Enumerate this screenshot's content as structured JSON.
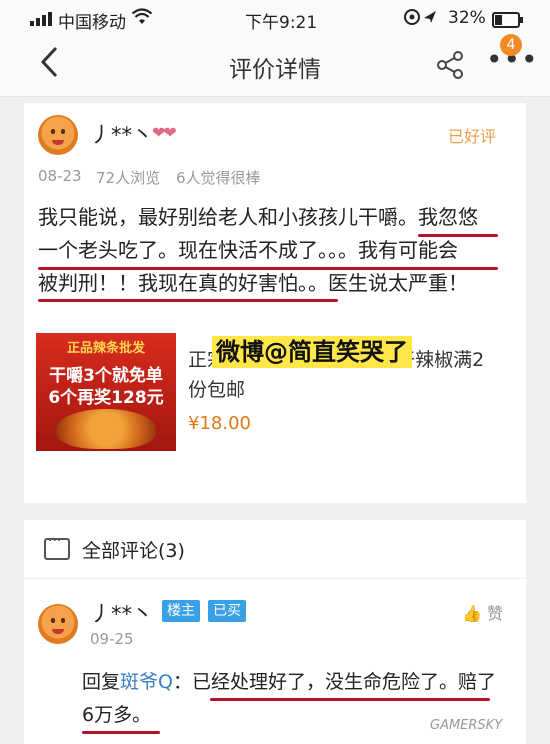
{
  "status_bar": {
    "carrier": "中国移动",
    "time": "下午9:21",
    "battery": "32%",
    "battery_level": 0.32
  },
  "nav": {
    "back_icon": "chevron-left-icon",
    "title": "评价详情",
    "share_icon": "share-icon",
    "more_icon": "more-dots-icon",
    "badge": "4"
  },
  "review": {
    "username": "丿**丶",
    "status": "已好评",
    "date": "08-23",
    "views": "72人浏览",
    "likes": "6人觉得很棒",
    "lines": [
      "我只能说，最好别给老人和小孩孩儿干嚼。我忽悠",
      "一个老头吃了。现在快活不成了。。。我有可能会",
      "被判刑！！我现在真的好害怕。。医生说太严重！"
    ],
    "product": {
      "thumb_header": "正品辣条批发",
      "thumb_line1": "干嚼3个就免单",
      "thumb_line2": "6个再奖128元",
      "title": "正宗...辣变态特辣象鼻辣干辣椒满2份包邮",
      "price": "¥18.00"
    },
    "watermark": "微博@简直笑哭了"
  },
  "comments": {
    "title": "全部评论(3)",
    "items": [
      {
        "username": "丿**丶",
        "tag_owner": "楼主",
        "tag_bought": "已买",
        "date": "09-25",
        "like": "赞",
        "reply_prefix": "回复",
        "mention": "斑爷Q",
        "text_line1": "：已经处理好了，没生命危险了。赔了",
        "text_line2": "6万多。"
      }
    ]
  },
  "source_watermark": "GAMERSKY",
  "colors": {
    "accent_orange": "#f08a24",
    "underline_red": "#b0132a",
    "tag_blue": "#3aa0e6",
    "watermark_yellow": "#ffe74a"
  }
}
